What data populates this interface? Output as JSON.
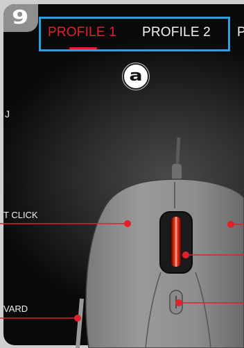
{
  "step": {
    "number": "9"
  },
  "tabs": [
    {
      "label": "PROFILE 1",
      "active": true
    },
    {
      "label": "PROFILE 2",
      "active": false
    },
    {
      "label": "P",
      "active": false
    }
  ],
  "callout": {
    "letter": "a"
  },
  "labels": {
    "left_click": "T CLICK",
    "forward": "VARD",
    "left_edge_glyph": "J"
  },
  "colors": {
    "accent_red": "#e2212b",
    "highlight_blue": "#2aa0de"
  }
}
